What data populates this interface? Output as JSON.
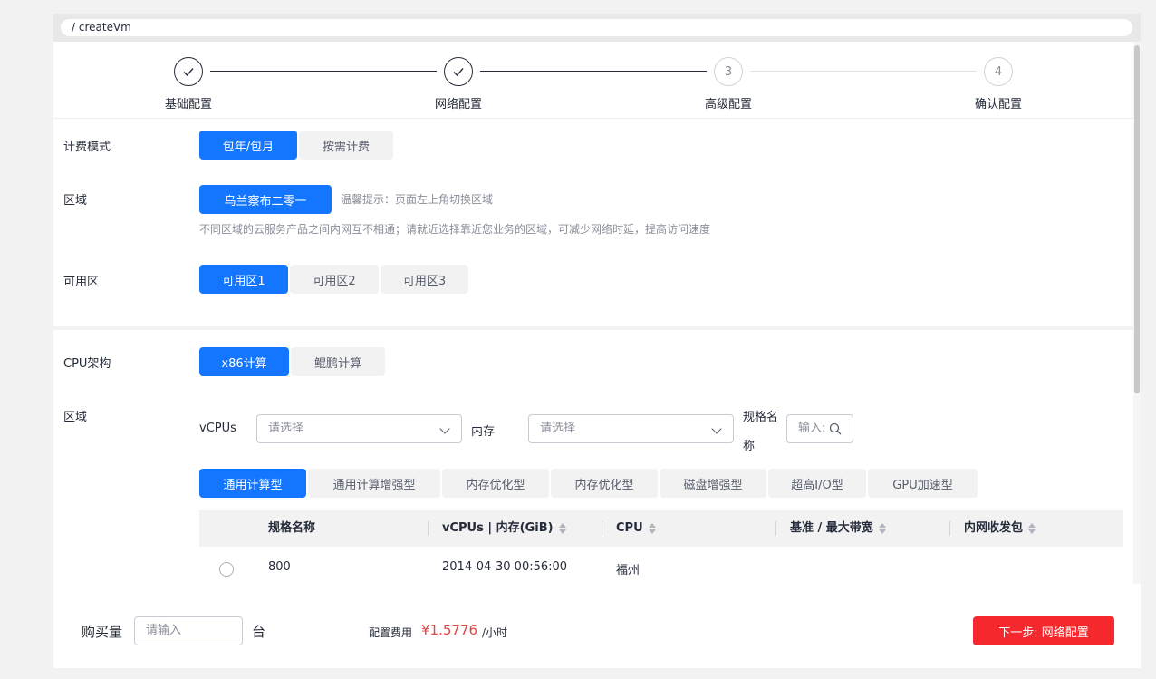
{
  "breadcrumb": "/ createVm",
  "steps": [
    {
      "label": "基础配置",
      "status": "done"
    },
    {
      "label": "网络配置",
      "status": "done"
    },
    {
      "label": "高级配置",
      "number": "3",
      "status": "pending"
    },
    {
      "label": "确认配置",
      "number": "4",
      "status": "pending"
    }
  ],
  "billing": {
    "label": "计费模式",
    "options": [
      "包年/包月",
      "按需计费"
    ],
    "selected": "包年/包月"
  },
  "region": {
    "label": "区域",
    "button": "乌兰察布二零一",
    "tip": "温馨提示：页面左上角切换区域",
    "note": "不同区域的云服务产品之间内网互不相通；请就近选择靠近您业务的区域，可减少网络时延，提高访问速度"
  },
  "az": {
    "label": "可用区",
    "options": [
      "可用区1",
      "可用区2",
      "可用区3"
    ],
    "selected": "可用区1"
  },
  "cpu_arch": {
    "label": "CPU架构",
    "options": [
      "x86计算",
      "鲲鹏计算"
    ],
    "selected": "x86计算"
  },
  "spec": {
    "label": "区域",
    "vcpus_label": "vCPUs",
    "vcpus_placeholder": "请选择",
    "memory_label": "内存",
    "memory_placeholder": "请选择",
    "name_label_line1": "规格名",
    "name_label_line2": "称",
    "name_placeholder": "输入:"
  },
  "flavor_tabs": [
    "通用计算型",
    "通用计算增强型",
    "内存优化型",
    "内存优化型",
    "磁盘增强型",
    "超高I/O型",
    "GPU加速型"
  ],
  "table": {
    "columns": [
      "规格名称",
      "vCPUs | 内存(GiB)",
      "CPU",
      "基准 / 最大带宽",
      "内网收发包"
    ],
    "rows": [
      {
        "name": "800",
        "vcpus": "2014-04-30 00:56:00",
        "cpu": "福州",
        "bandwidth": "",
        "pps": ""
      }
    ]
  },
  "footer": {
    "qty_label": "购买量",
    "qty_placeholder": "请输入",
    "qty_unit": "台",
    "fee_label": "配置费用",
    "fee_value": "¥1.5776",
    "fee_unit": "/小时",
    "next_button": "下一步: 网络配置"
  },
  "colors": {
    "accent": "#1476ff",
    "danger": "#f5282d",
    "price": "#e54545"
  }
}
